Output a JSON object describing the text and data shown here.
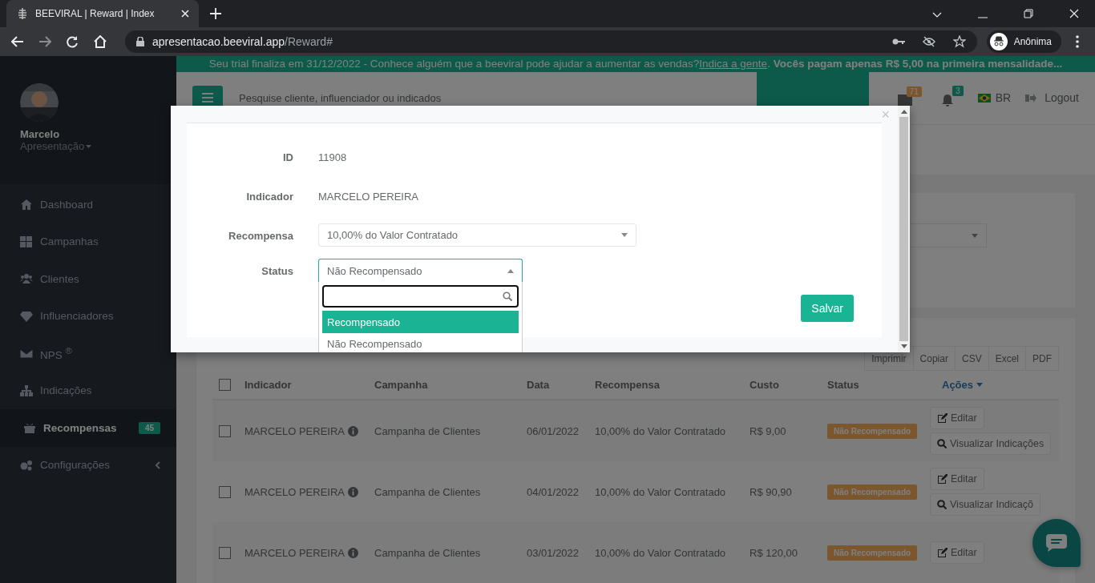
{
  "browser": {
    "tab_title": "BEEVIRAL | Reward | Index",
    "url_host": "apresentacao.beeviral.app",
    "url_path": "/Reward#",
    "profile": "Anônima"
  },
  "banner": {
    "text_before": "Seu trial finaliza em 31/12/2022 - Conhece alguém que a beeviral pode ajudar a aumentar as vendas? ",
    "link": "Indica a gente",
    "text_after": ". **Vocês pagam apenas R$ 5,00 na primeira mensalidade...**"
  },
  "header": {
    "search_placeholder": "Pesquise cliente, influenciador ou indicados",
    "mail_count": "71",
    "bell_count": "3",
    "language": "BR",
    "logout": "Logout"
  },
  "sidebar": {
    "user_name": "Marcelo",
    "user_role": "Apresentação",
    "items": [
      {
        "label": "Dashboard",
        "selected": false
      },
      {
        "label": "Campanhas",
        "selected": false
      },
      {
        "label": "Clientes",
        "selected": false
      },
      {
        "label": "Influenciadores",
        "selected": false
      },
      {
        "label": "NPS $^{®}$",
        "selected": false
      },
      {
        "label": "Indicações",
        "selected": false
      },
      {
        "label": "Recompensas",
        "selected": true,
        "badge": "45"
      },
      {
        "label": "Configurações",
        "selected": false,
        "submenu": true
      }
    ]
  },
  "table": {
    "select_all_checked": false,
    "export_buttons": [
      "Imprimir",
      "Copiar",
      "CSV",
      "Excel",
      "PDF"
    ],
    "columns": [
      "Indicador",
      "Campanha",
      "Data",
      "Recompensa",
      "Custo",
      "Status",
      "Ações"
    ],
    "rows": [
      {
        "checked": false,
        "indicador": "MARCELO PEREIRA",
        "campanha": "Campanha de Clientes",
        "data": "06/01/2022",
        "recompensa": "10,00% do Valor Contratado",
        "custo": "R$ 9,00",
        "status": "Não Recompensado",
        "actions": [
          "Editar",
          "Visualizar Indicações"
        ]
      },
      {
        "checked": false,
        "indicador": "MARCELO PEREIRA",
        "campanha": "Campanha de Clientes",
        "data": "04/01/2022",
        "recompensa": "10,00% do Valor Contratado",
        "custo": "R$ 90,90",
        "status": "Não Recompensado",
        "actions": [
          "Editar",
          "Visualizar Indicaçõ"
        ]
      },
      {
        "checked": false,
        "indicador": "MARCELO PEREIRA",
        "campanha": "Campanha de Clientes",
        "data": "03/01/2022",
        "recompensa": "10,00% do Valor Contratado",
        "custo": "R$ 120,00",
        "status": "Não Recompensado",
        "actions": [
          "Editar"
        ]
      }
    ]
  },
  "modal": {
    "close": "×",
    "save_button": "Salvar",
    "fields": [
      {
        "label": "ID",
        "kind": "text",
        "value": "11908"
      },
      {
        "label": "Indicador",
        "kind": "text",
        "value": "MARCELO PEREIRA"
      },
      {
        "label": "Recompensa",
        "kind": "select",
        "value": "10,00% do Valor Contratado",
        "open": false
      },
      {
        "label": "Status",
        "kind": "select",
        "value": "Não Recompensado",
        "open": true,
        "options": [
          {
            "label": "Recompensado",
            "highlighted": true
          },
          {
            "label": "Não Recompensado",
            "highlighted": false
          }
        ]
      }
    ]
  }
}
